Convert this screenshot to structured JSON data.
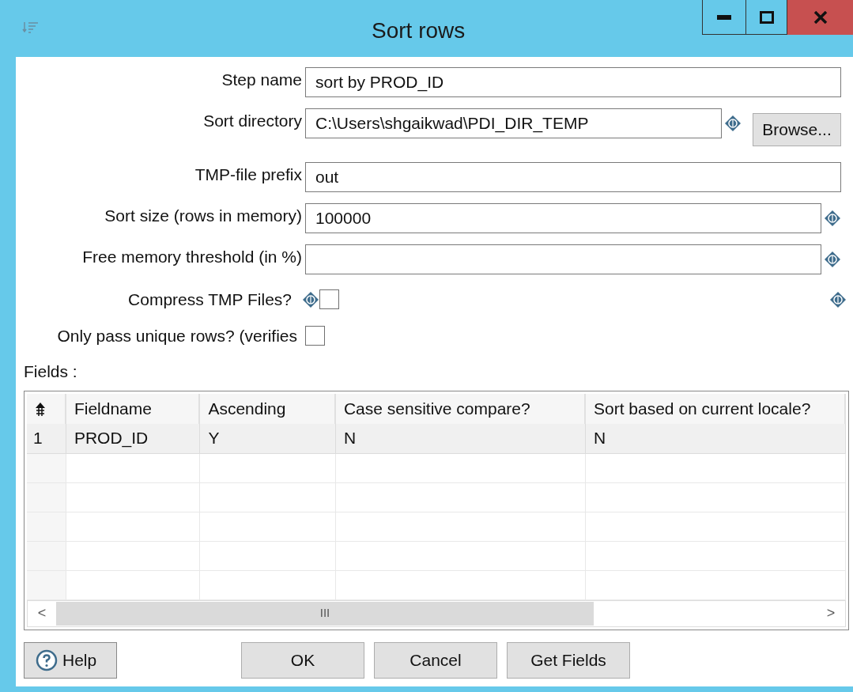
{
  "window": {
    "title": "Sort rows"
  },
  "form": [
    {
      "kind": "text",
      "label": "Step name",
      "value": "sort by PROD_ID"
    },
    {
      "kind": "text_var_browse",
      "label": "Sort directory",
      "value": "C:\\Users\\shgaikwad\\PDI_DIR_TEMP",
      "button": "Browse..."
    },
    {
      "kind": "text",
      "label": "TMP-file prefix",
      "value": "out"
    },
    {
      "kind": "text_var",
      "label": "Sort size (rows in memory)",
      "value": "100000"
    },
    {
      "kind": "text_var",
      "label": "Free memory threshold (in %)"
    },
    {
      "kind": "checkbox_var",
      "label": "Compress TMP Files?",
      "checked": false
    },
    {
      "kind": "checkbox",
      "label": "Only pass unique rows? (verifies",
      "checked": false
    }
  ],
  "fields_label": "Fields :",
  "table": {
    "columns": [
      "Fieldname",
      "Ascending",
      "Case sensitive compare?",
      "Sort based on current locale?"
    ],
    "rows": [
      {
        "number": "1",
        "cells": [
          "PROD_ID",
          "Y",
          "N",
          "N"
        ]
      }
    ],
    "scroll_glyph": "III",
    "scroll_left": "<",
    "scroll_right": ">"
  },
  "buttons": {
    "help": "Help",
    "actions": [
      "OK",
      "Cancel",
      "Get Fields"
    ]
  }
}
